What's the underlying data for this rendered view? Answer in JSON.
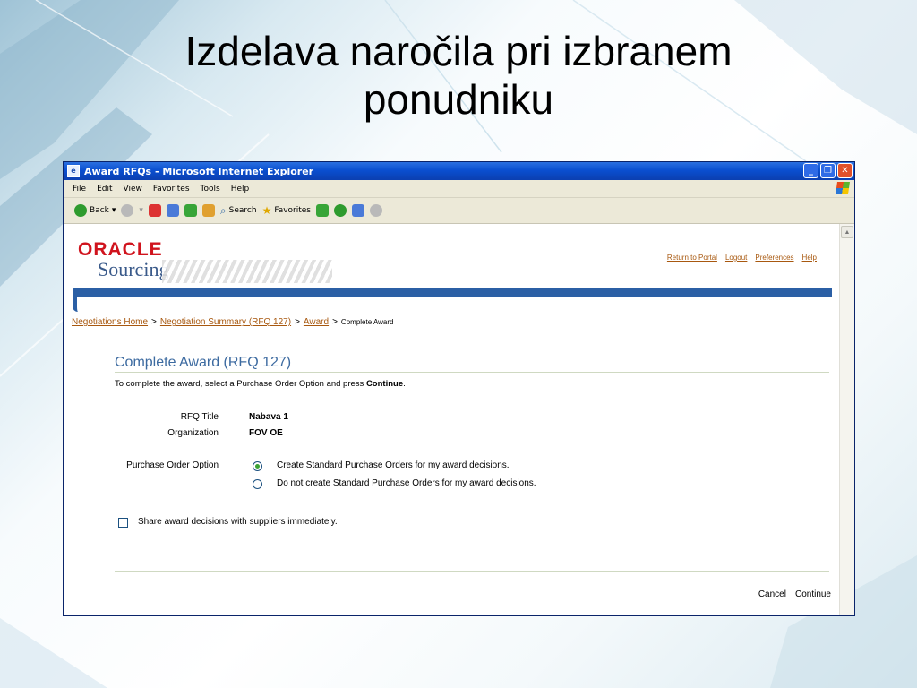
{
  "slide": {
    "title_line1": "Izdelava naročila pri izbranem",
    "title_line2": "ponudniku"
  },
  "window": {
    "title": "Award RFQs - Microsoft Internet Explorer",
    "menu": [
      "File",
      "Edit",
      "View",
      "Favorites",
      "Tools",
      "Help"
    ],
    "toolbar": {
      "back": "Back",
      "search": "Search",
      "favorites": "Favorites"
    }
  },
  "app": {
    "logo_top": "ORACLE",
    "logo_bottom": "Sourcing",
    "global_links": [
      "Return to Portal",
      "Logout",
      "Preferences",
      "Help"
    ],
    "breadcrumb": {
      "items": [
        "Negotiations Home",
        "Negotiation Summary (RFQ 127)",
        "Award"
      ],
      "current": "Complete Award",
      "separator": ">"
    },
    "page_title": "Complete Award (RFQ 127)",
    "instruction_pre": "To complete the award, select a Purchase Order Option and press ",
    "instruction_bold": "Continue",
    "instruction_post": ".",
    "fields": {
      "rfq_title_label": "RFQ Title",
      "rfq_title_value": "Nabava 1",
      "organization_label": "Organization",
      "organization_value": "FOV OE"
    },
    "po_option": {
      "label": "Purchase Order Option",
      "options": [
        "Create Standard Purchase Orders for my award decisions.",
        "Do not create Standard Purchase Orders for my award decisions."
      ],
      "selected_index": 0
    },
    "share_checkbox_label": "Share award decisions with suppliers immediately.",
    "share_checked": false,
    "actions": {
      "cancel": "Cancel",
      "continue": "Continue"
    }
  },
  "colors": {
    "accent_blue": "#2b5fa5",
    "link_orange": "#a8580f",
    "oracle_red": "#d0131d"
  }
}
